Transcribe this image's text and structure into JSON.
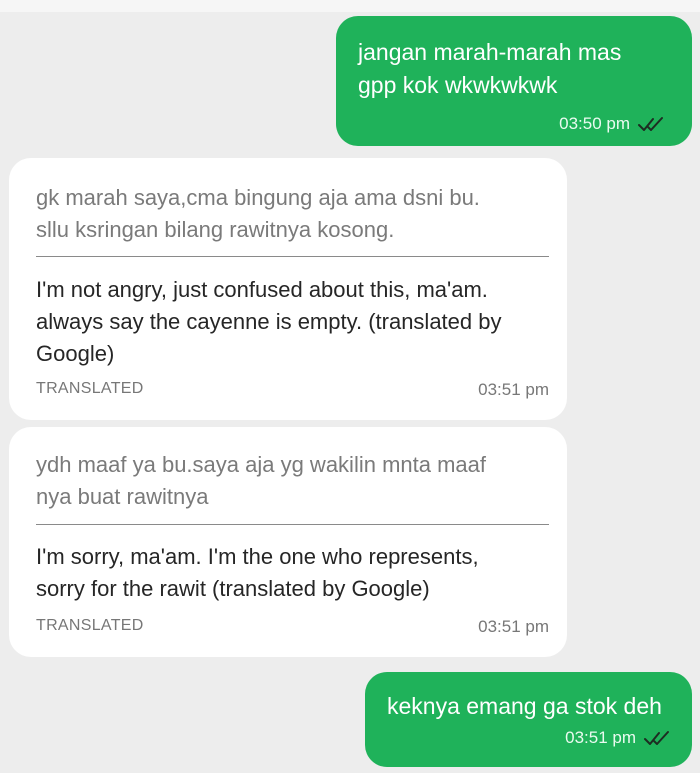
{
  "messages": [
    {
      "direction": "out",
      "text": "jangan marah-marah mas\ngpp kok wkwkwkwk",
      "time": "03:50 pm",
      "status_icon": "double-check-icon"
    },
    {
      "direction": "in",
      "original": "gk marah saya,cma bingung aja ama dsni bu.\nsllu ksringan bilang rawitnya kosong.",
      "translation": "I'm not angry, just confused about this, ma'am.\nalways say the cayenne is empty. (translated by\nGoogle)",
      "label": "TRANSLATED",
      "time": "03:51 pm"
    },
    {
      "direction": "in",
      "original": "ydh maaf ya bu.saya aja yg wakilin mnta maaf\nnya buat rawitnya",
      "translation": "I'm sorry, ma'am. I'm the one who represents,\nsorry for the rawit (translated by Google)",
      "label": "TRANSLATED",
      "time": "03:51 pm"
    },
    {
      "direction": "out",
      "text": "keknya emang ga stok deh",
      "time": "03:51 pm",
      "status_icon": "double-check-icon"
    }
  ],
  "colors": {
    "background": "#ededed",
    "outgoing_bubble": "#1fb25a",
    "incoming_bubble": "#ffffff"
  }
}
